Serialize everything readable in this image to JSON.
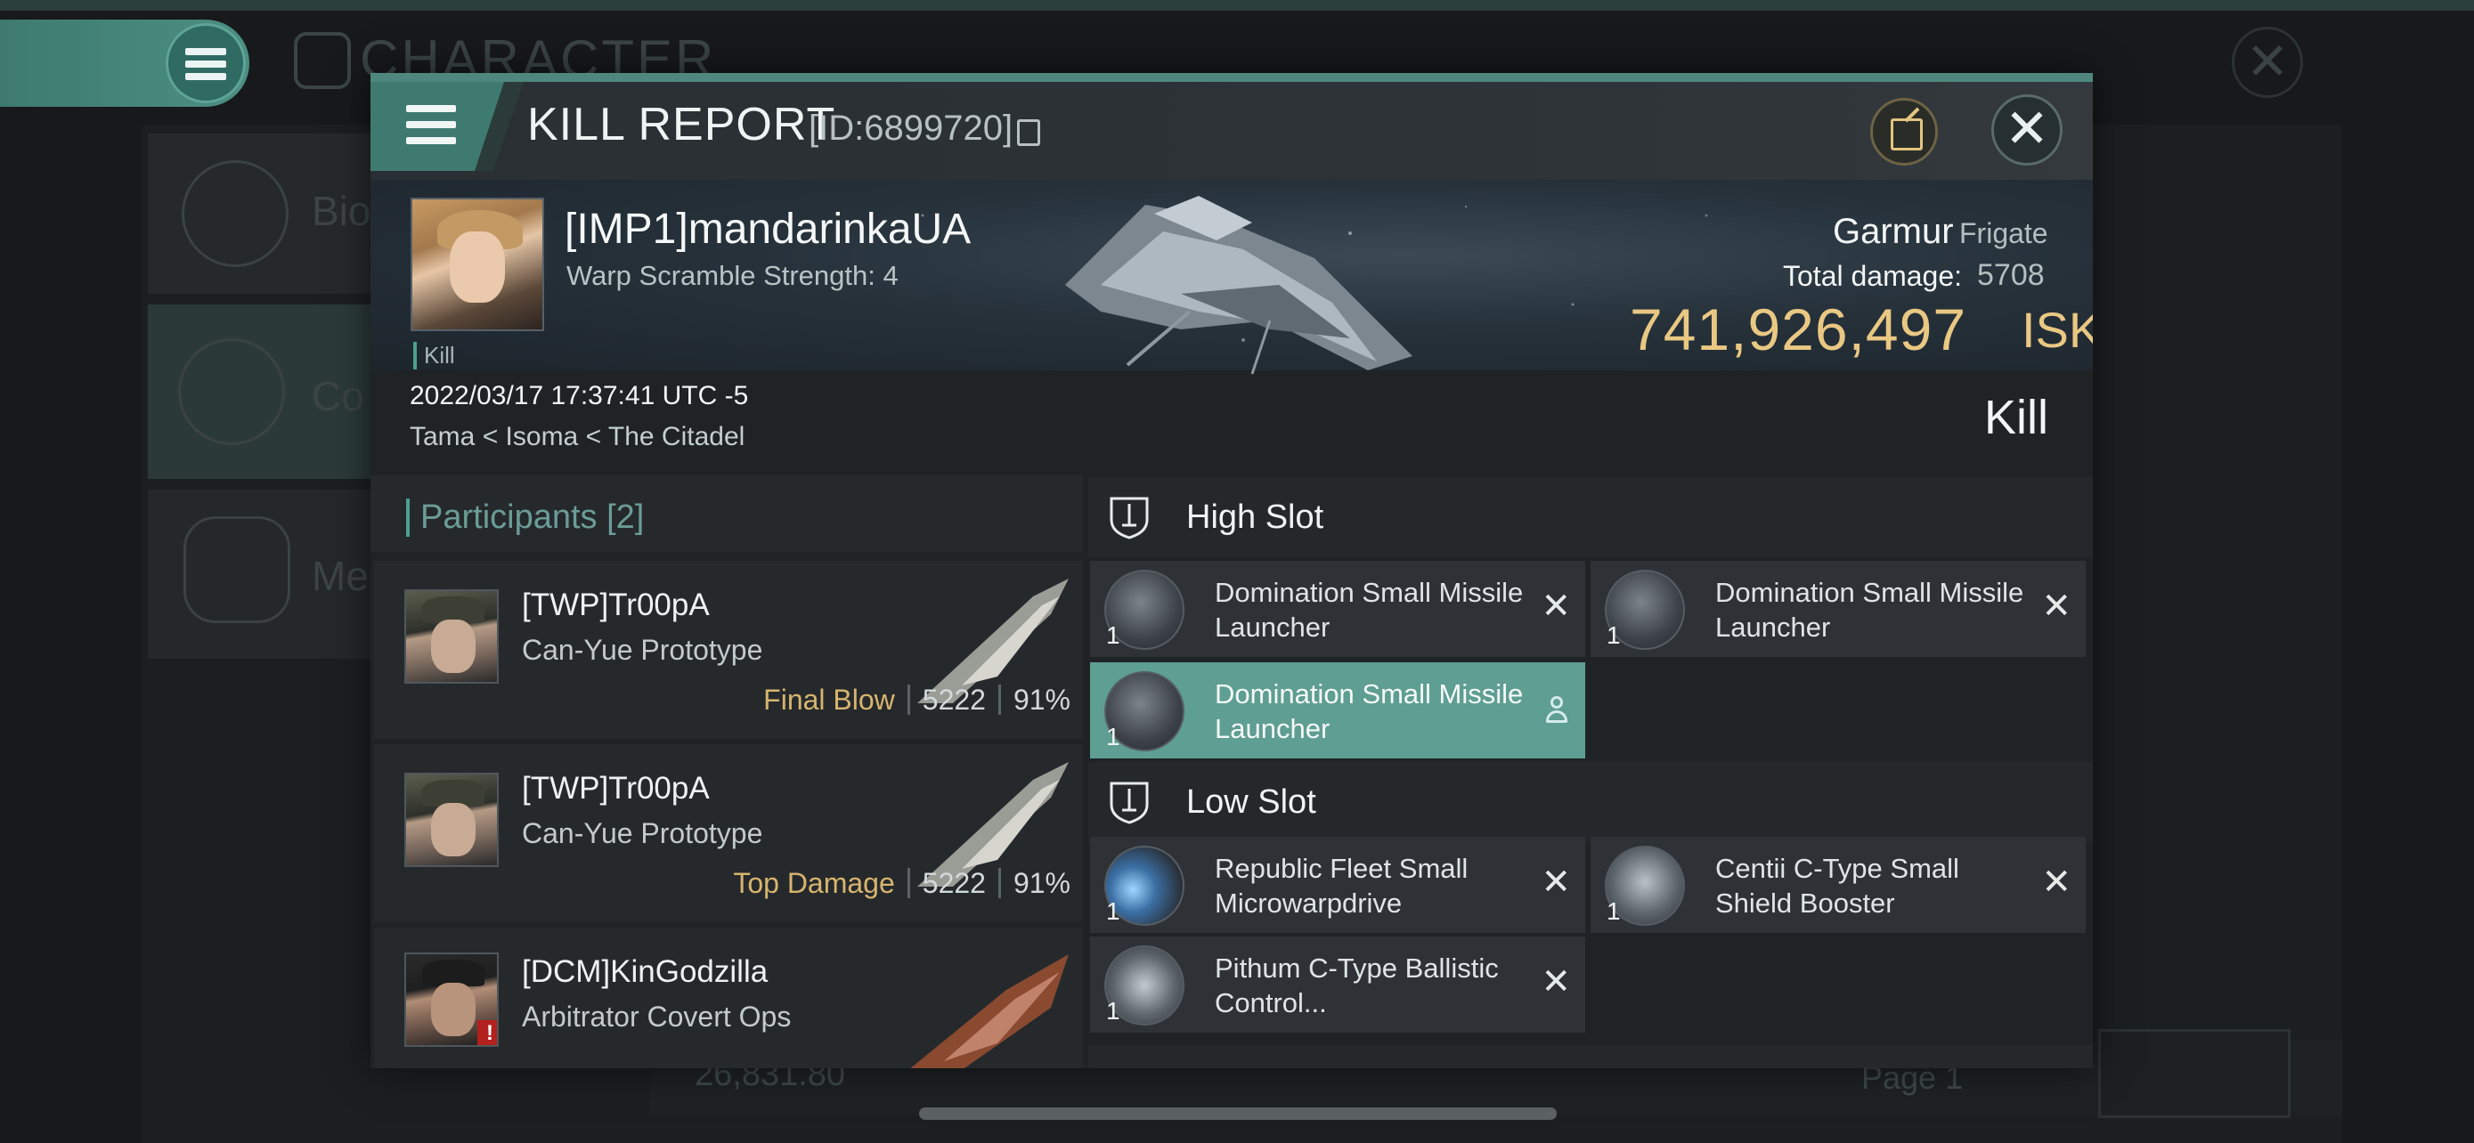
{
  "background": {
    "title": "CHARACTER",
    "sidebar_items": [
      "Bio",
      "Co",
      "Me"
    ],
    "footer_value": "26,831.80",
    "footer_page": "Page 1"
  },
  "modal": {
    "title": "KILL REPORT",
    "id": "[ID:6899720]",
    "close_glyph": "✕",
    "share_icon": "share-icon"
  },
  "victim": {
    "name": "[IMP1]mandarinkaUA",
    "warp_scramble": "Warp Scramble Strength: 4",
    "tag": "Kill",
    "timestamp": "2022/03/17 17:37:41 UTC -5",
    "location": "Tama < Isoma < The Citadel",
    "ship_name": "Garmur",
    "ship_class": "Frigate",
    "total_damage_label": "Total damage:",
    "total_damage": "5708",
    "isk_value": "741,926,497",
    "isk_unit": "ISK",
    "result": "Kill"
  },
  "participants": {
    "label": "Participants",
    "count": "[2]",
    "rows": [
      {
        "name": "[TWP]Tr00pA",
        "ship": "Can-Yue Prototype",
        "tag": "Final Blow",
        "damage": "5222",
        "percent": "91%"
      },
      {
        "name": "[TWP]Tr00pA",
        "ship": "Can-Yue Prototype",
        "tag": "Top Damage",
        "damage": "5222",
        "percent": "91%"
      },
      {
        "name": "[DCM]KinGodzilla",
        "ship": "Arbitrator Covert Ops",
        "tag": "",
        "damage": "",
        "percent": ""
      }
    ]
  },
  "fitting": {
    "high_slot": {
      "title": "High Slot",
      "modules": [
        {
          "name": "Domination Small Missile Launcher",
          "qty": "1",
          "status": "destroyed"
        },
        {
          "name": "Domination Small Missile Launcher",
          "qty": "1",
          "status": "destroyed"
        },
        {
          "name": "Domination Small Missile Launcher",
          "qty": "1",
          "status": "dropped"
        }
      ]
    },
    "low_slot": {
      "title": "Low Slot",
      "modules": [
        {
          "name": "Republic Fleet Small Microwarpdrive",
          "qty": "1",
          "status": "destroyed"
        },
        {
          "name": "Centii C-Type Small Shield Booster",
          "qty": "1",
          "status": "destroyed"
        },
        {
          "name": "Pithum C-Type Ballistic Control...",
          "qty": "1",
          "status": "destroyed"
        }
      ]
    },
    "destroyed_glyph": "✕"
  },
  "colors": {
    "accent": "#4f877e",
    "isk": "#e9c883",
    "final_blow": "#d7b56f",
    "dropped_module": "#5f9e92"
  }
}
